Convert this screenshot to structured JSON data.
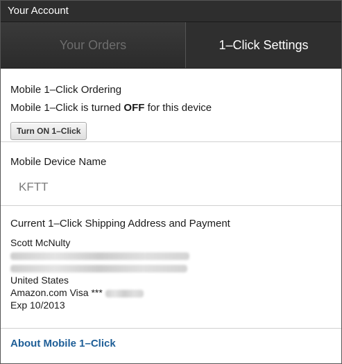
{
  "window": {
    "title": "Your Account"
  },
  "tabs": [
    {
      "label": "Your Orders",
      "selected": false
    },
    {
      "label": "1–Click Settings",
      "selected": true
    }
  ],
  "ordering": {
    "heading": "Mobile 1–Click Ordering",
    "status_prefix": "Mobile 1–Click is turned ",
    "status_value": "OFF",
    "status_suffix": " for this device",
    "button_label": "Turn ON 1–Click"
  },
  "device": {
    "heading": "Mobile Device Name",
    "name": "KFTT"
  },
  "address": {
    "heading": "Current 1–Click Shipping Address and Payment",
    "name": "Scott McNulty",
    "country": "United States",
    "card": "Amazon.com Visa ***",
    "expiry": "Exp 10/2013"
  },
  "about_link": "About Mobile 1–Click",
  "colors": {
    "titlebar_bg": "#2e2e2e",
    "tab_bg": "#2f2f2f",
    "link": "#1e5e97"
  }
}
